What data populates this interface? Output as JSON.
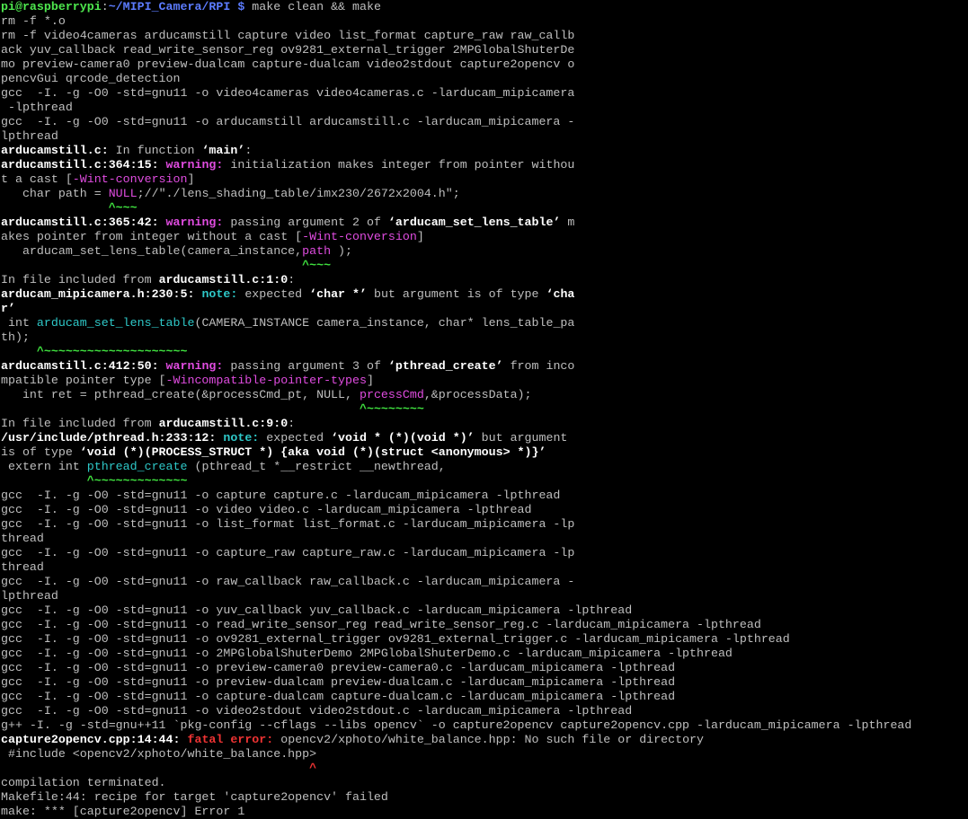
{
  "terminal": {
    "lines": [
      [
        {
          "t": "pi@raspberrypi",
          "s": "prompt"
        },
        {
          "t": ":",
          "s": "plain"
        },
        {
          "t": "~/MIPI_Camera/RPI $",
          "s": "path"
        },
        {
          "t": " make clean && make",
          "s": "plain"
        }
      ],
      [
        {
          "t": "rm -f *.o",
          "s": "plain"
        }
      ],
      [
        {
          "t": "rm -f video4cameras arducamstill capture video list_format capture_raw raw_callb",
          "s": "plain"
        }
      ],
      [
        {
          "t": "ack yuv_callback read_write_sensor_reg ov9281_external_trigger 2MPGlobalShuterDe",
          "s": "plain"
        }
      ],
      [
        {
          "t": "mo preview-camera0 preview-dualcam capture-dualcam video2stdout capture2opencv o",
          "s": "plain"
        }
      ],
      [
        {
          "t": "pencvGui qrcode_detection",
          "s": "plain"
        }
      ],
      [
        {
          "t": "gcc  -I. -g -O0 -std=gnu11 -o video4cameras video4cameras.c -larducam_mipicamera",
          "s": "plain"
        }
      ],
      [
        {
          "t": " -lpthread",
          "s": "plain"
        }
      ],
      [
        {
          "t": "gcc  -I. -g -O0 -std=gnu11 -o arducamstill arducamstill.c -larducam_mipicamera -",
          "s": "plain"
        }
      ],
      [
        {
          "t": "lpthread",
          "s": "plain"
        }
      ],
      [
        {
          "t": "arducamstill.c:",
          "s": "bold"
        },
        {
          "t": " In function ",
          "s": "plain"
        },
        {
          "t": "‘main’",
          "s": "bold"
        },
        {
          "t": ":",
          "s": "plain"
        }
      ],
      [
        {
          "t": "arducamstill.c:364:15:",
          "s": "bold"
        },
        {
          "t": " ",
          "s": "plain"
        },
        {
          "t": "warning:",
          "s": "warning"
        },
        {
          "t": " initialization makes integer from pointer withou",
          "s": "plain"
        }
      ],
      [
        {
          "t": "t a cast [",
          "s": "plain"
        },
        {
          "t": "-Wint-conversion",
          "s": "flag"
        },
        {
          "t": "]",
          "s": "plain"
        }
      ],
      [
        {
          "t": "   char path = ",
          "s": "plain"
        },
        {
          "t": "NULL",
          "s": "magenta"
        },
        {
          "t": ";//\"./lens_shading_table/imx230/2672x2004.h\";",
          "s": "plain"
        }
      ],
      [
        {
          "t": "               ",
          "s": "plain"
        },
        {
          "t": "^~~~",
          "s": "caret"
        }
      ],
      [
        {
          "t": "arducamstill.c:365:42:",
          "s": "bold"
        },
        {
          "t": " ",
          "s": "plain"
        },
        {
          "t": "warning:",
          "s": "warning"
        },
        {
          "t": " passing argument 2 of ",
          "s": "plain"
        },
        {
          "t": "‘arducam_set_lens_table’",
          "s": "bold"
        },
        {
          "t": " m",
          "s": "plain"
        }
      ],
      [
        {
          "t": "akes pointer from integer without a cast [",
          "s": "plain"
        },
        {
          "t": "-Wint-conversion",
          "s": "flag"
        },
        {
          "t": "]",
          "s": "plain"
        }
      ],
      [
        {
          "t": "   arducam_set_lens_table(camera_instance,",
          "s": "plain"
        },
        {
          "t": "path",
          "s": "magenta"
        },
        {
          "t": " );",
          "s": "plain"
        }
      ],
      [
        {
          "t": "                                          ",
          "s": "plain"
        },
        {
          "t": "^~~~",
          "s": "caret"
        }
      ],
      [
        {
          "t": "In file included from ",
          "s": "plain"
        },
        {
          "t": "arducamstill.c:1:0",
          "s": "bold"
        },
        {
          "t": ":",
          "s": "plain"
        }
      ],
      [
        {
          "t": "arducam_mipicamera.h:230:5:",
          "s": "bold"
        },
        {
          "t": " ",
          "s": "plain"
        },
        {
          "t": "note:",
          "s": "note"
        },
        {
          "t": " expected ",
          "s": "plain"
        },
        {
          "t": "‘char *’",
          "s": "bold"
        },
        {
          "t": " but argument is of type ",
          "s": "plain"
        },
        {
          "t": "‘cha",
          "s": "bold"
        }
      ],
      [
        {
          "t": "r’",
          "s": "bold"
        }
      ],
      [
        {
          "t": " int ",
          "s": "plain"
        },
        {
          "t": "arducam_set_lens_table",
          "s": "cyan"
        },
        {
          "t": "(CAMERA_INSTANCE camera_instance, char* lens_table_pa",
          "s": "plain"
        }
      ],
      [
        {
          "t": "th);",
          "s": "plain"
        }
      ],
      [
        {
          "t": "     ",
          "s": "plain"
        },
        {
          "t": "^~~~~~~~~~~~~~~~~~~~~",
          "s": "caret"
        }
      ],
      [
        {
          "t": "arducamstill.c:412:50:",
          "s": "bold"
        },
        {
          "t": " ",
          "s": "plain"
        },
        {
          "t": "warning:",
          "s": "warning"
        },
        {
          "t": " passing argument 3 of ",
          "s": "plain"
        },
        {
          "t": "‘pthread_create’",
          "s": "bold"
        },
        {
          "t": " from inco",
          "s": "plain"
        }
      ],
      [
        {
          "t": "mpatible pointer type [",
          "s": "plain"
        },
        {
          "t": "-Wincompatible-pointer-types",
          "s": "flag"
        },
        {
          "t": "]",
          "s": "plain"
        }
      ],
      [
        {
          "t": "   int ret = pthread_create(&processCmd_pt, NULL, ",
          "s": "plain"
        },
        {
          "t": "prcessCmd",
          "s": "magenta"
        },
        {
          "t": ",&processData);",
          "s": "plain"
        }
      ],
      [
        {
          "t": "                                                  ",
          "s": "plain"
        },
        {
          "t": "^~~~~~~~~",
          "s": "caret"
        }
      ],
      [
        {
          "t": "In file included from ",
          "s": "plain"
        },
        {
          "t": "arducamstill.c:9:0",
          "s": "bold"
        },
        {
          "t": ":",
          "s": "plain"
        }
      ],
      [
        {
          "t": "/usr/include/pthread.h:233:12:",
          "s": "bold"
        },
        {
          "t": " ",
          "s": "plain"
        },
        {
          "t": "note:",
          "s": "note"
        },
        {
          "t": " expected ",
          "s": "plain"
        },
        {
          "t": "‘void * (*)(void *)’",
          "s": "bold"
        },
        {
          "t": " but argument",
          "s": "plain"
        }
      ],
      [
        {
          "t": "is of type ",
          "s": "plain"
        },
        {
          "t": "‘void (*)(PROCESS_STRUCT *) {aka void (*)(struct <anonymous> *)}’",
          "s": "bold"
        }
      ],
      [
        {
          "t": " extern int ",
          "s": "plain"
        },
        {
          "t": "pthread_create",
          "s": "cyan"
        },
        {
          "t": " (pthread_t *__restrict __newthread,",
          "s": "plain"
        }
      ],
      [
        {
          "t": "            ",
          "s": "plain"
        },
        {
          "t": "^~~~~~~~~~~~~~",
          "s": "caret"
        }
      ],
      [
        {
          "t": "gcc  -I. -g -O0 -std=gnu11 -o capture capture.c -larducam_mipicamera -lpthread",
          "s": "plain"
        }
      ],
      [
        {
          "t": "gcc  -I. -g -O0 -std=gnu11 -o video video.c -larducam_mipicamera -lpthread",
          "s": "plain"
        }
      ],
      [
        {
          "t": "gcc  -I. -g -O0 -std=gnu11 -o list_format list_format.c -larducam_mipicamera -lp",
          "s": "plain"
        }
      ],
      [
        {
          "t": "thread",
          "s": "plain"
        }
      ],
      [
        {
          "t": "gcc  -I. -g -O0 -std=gnu11 -o capture_raw capture_raw.c -larducam_mipicamera -lp",
          "s": "plain"
        }
      ],
      [
        {
          "t": "thread",
          "s": "plain"
        }
      ],
      [
        {
          "t": "gcc  -I. -g -O0 -std=gnu11 -o raw_callback raw_callback.c -larducam_mipicamera -",
          "s": "plain"
        }
      ],
      [
        {
          "t": "lpthread",
          "s": "plain"
        }
      ],
      [
        {
          "t": "gcc  -I. -g -O0 -std=gnu11 -o yuv_callback yuv_callback.c -larducam_mipicamera -lpthread",
          "s": "plain"
        }
      ],
      [
        {
          "t": "gcc  -I. -g -O0 -std=gnu11 -o read_write_sensor_reg read_write_sensor_reg.c -larducam_mipicamera -lpthread",
          "s": "plain"
        }
      ],
      [
        {
          "t": "gcc  -I. -g -O0 -std=gnu11 -o ov9281_external_trigger ov9281_external_trigger.c -larducam_mipicamera -lpthread",
          "s": "plain"
        }
      ],
      [
        {
          "t": "gcc  -I. -g -O0 -std=gnu11 -o 2MPGlobalShuterDemo 2MPGlobalShuterDemo.c -larducam_mipicamera -lpthread",
          "s": "plain"
        }
      ],
      [
        {
          "t": "gcc  -I. -g -O0 -std=gnu11 -o preview-camera0 preview-camera0.c -larducam_mipicamera -lpthread",
          "s": "plain"
        }
      ],
      [
        {
          "t": "gcc  -I. -g -O0 -std=gnu11 -o preview-dualcam preview-dualcam.c -larducam_mipicamera -lpthread",
          "s": "plain"
        }
      ],
      [
        {
          "t": "gcc  -I. -g -O0 -std=gnu11 -o capture-dualcam capture-dualcam.c -larducam_mipicamera -lpthread",
          "s": "plain"
        }
      ],
      [
        {
          "t": "gcc  -I. -g -O0 -std=gnu11 -o video2stdout video2stdout.c -larducam_mipicamera -lpthread",
          "s": "plain"
        }
      ],
      [
        {
          "t": "g++ -I. -g -std=gnu++11 `pkg-config --cflags --libs opencv` -o capture2opencv capture2opencv.cpp -larducam_mipicamera -lpthread",
          "s": "plain"
        }
      ],
      [
        {
          "t": "capture2opencv.cpp:14:44:",
          "s": "bold"
        },
        {
          "t": " ",
          "s": "plain"
        },
        {
          "t": "fatal error:",
          "s": "error"
        },
        {
          "t": " opencv2/xphoto/white_balance.hpp: No such file or directory",
          "s": "plain"
        }
      ],
      [
        {
          "t": " #include <opencv2/xphoto/white_balance.hpp>",
          "s": "plain"
        }
      ],
      [
        {
          "t": "                                           ",
          "s": "plain"
        },
        {
          "t": "^",
          "s": "redcaret"
        }
      ],
      [
        {
          "t": "compilation terminated.",
          "s": "plain"
        }
      ],
      [
        {
          "t": "Makefile:44: recipe for target 'capture2opencv' failed",
          "s": "plain"
        }
      ],
      [
        {
          "t": "make: *** [capture2opencv] Error 1",
          "s": "plain"
        }
      ]
    ]
  },
  "colors": {
    "background": "#000000",
    "text": "#bfbfbf",
    "prompt": "#4ee84e",
    "path": "#5c7cff",
    "warning": "#e04ce0",
    "note": "#2ec8c8",
    "error": "#ee3333",
    "caret": "#3fe03f"
  }
}
